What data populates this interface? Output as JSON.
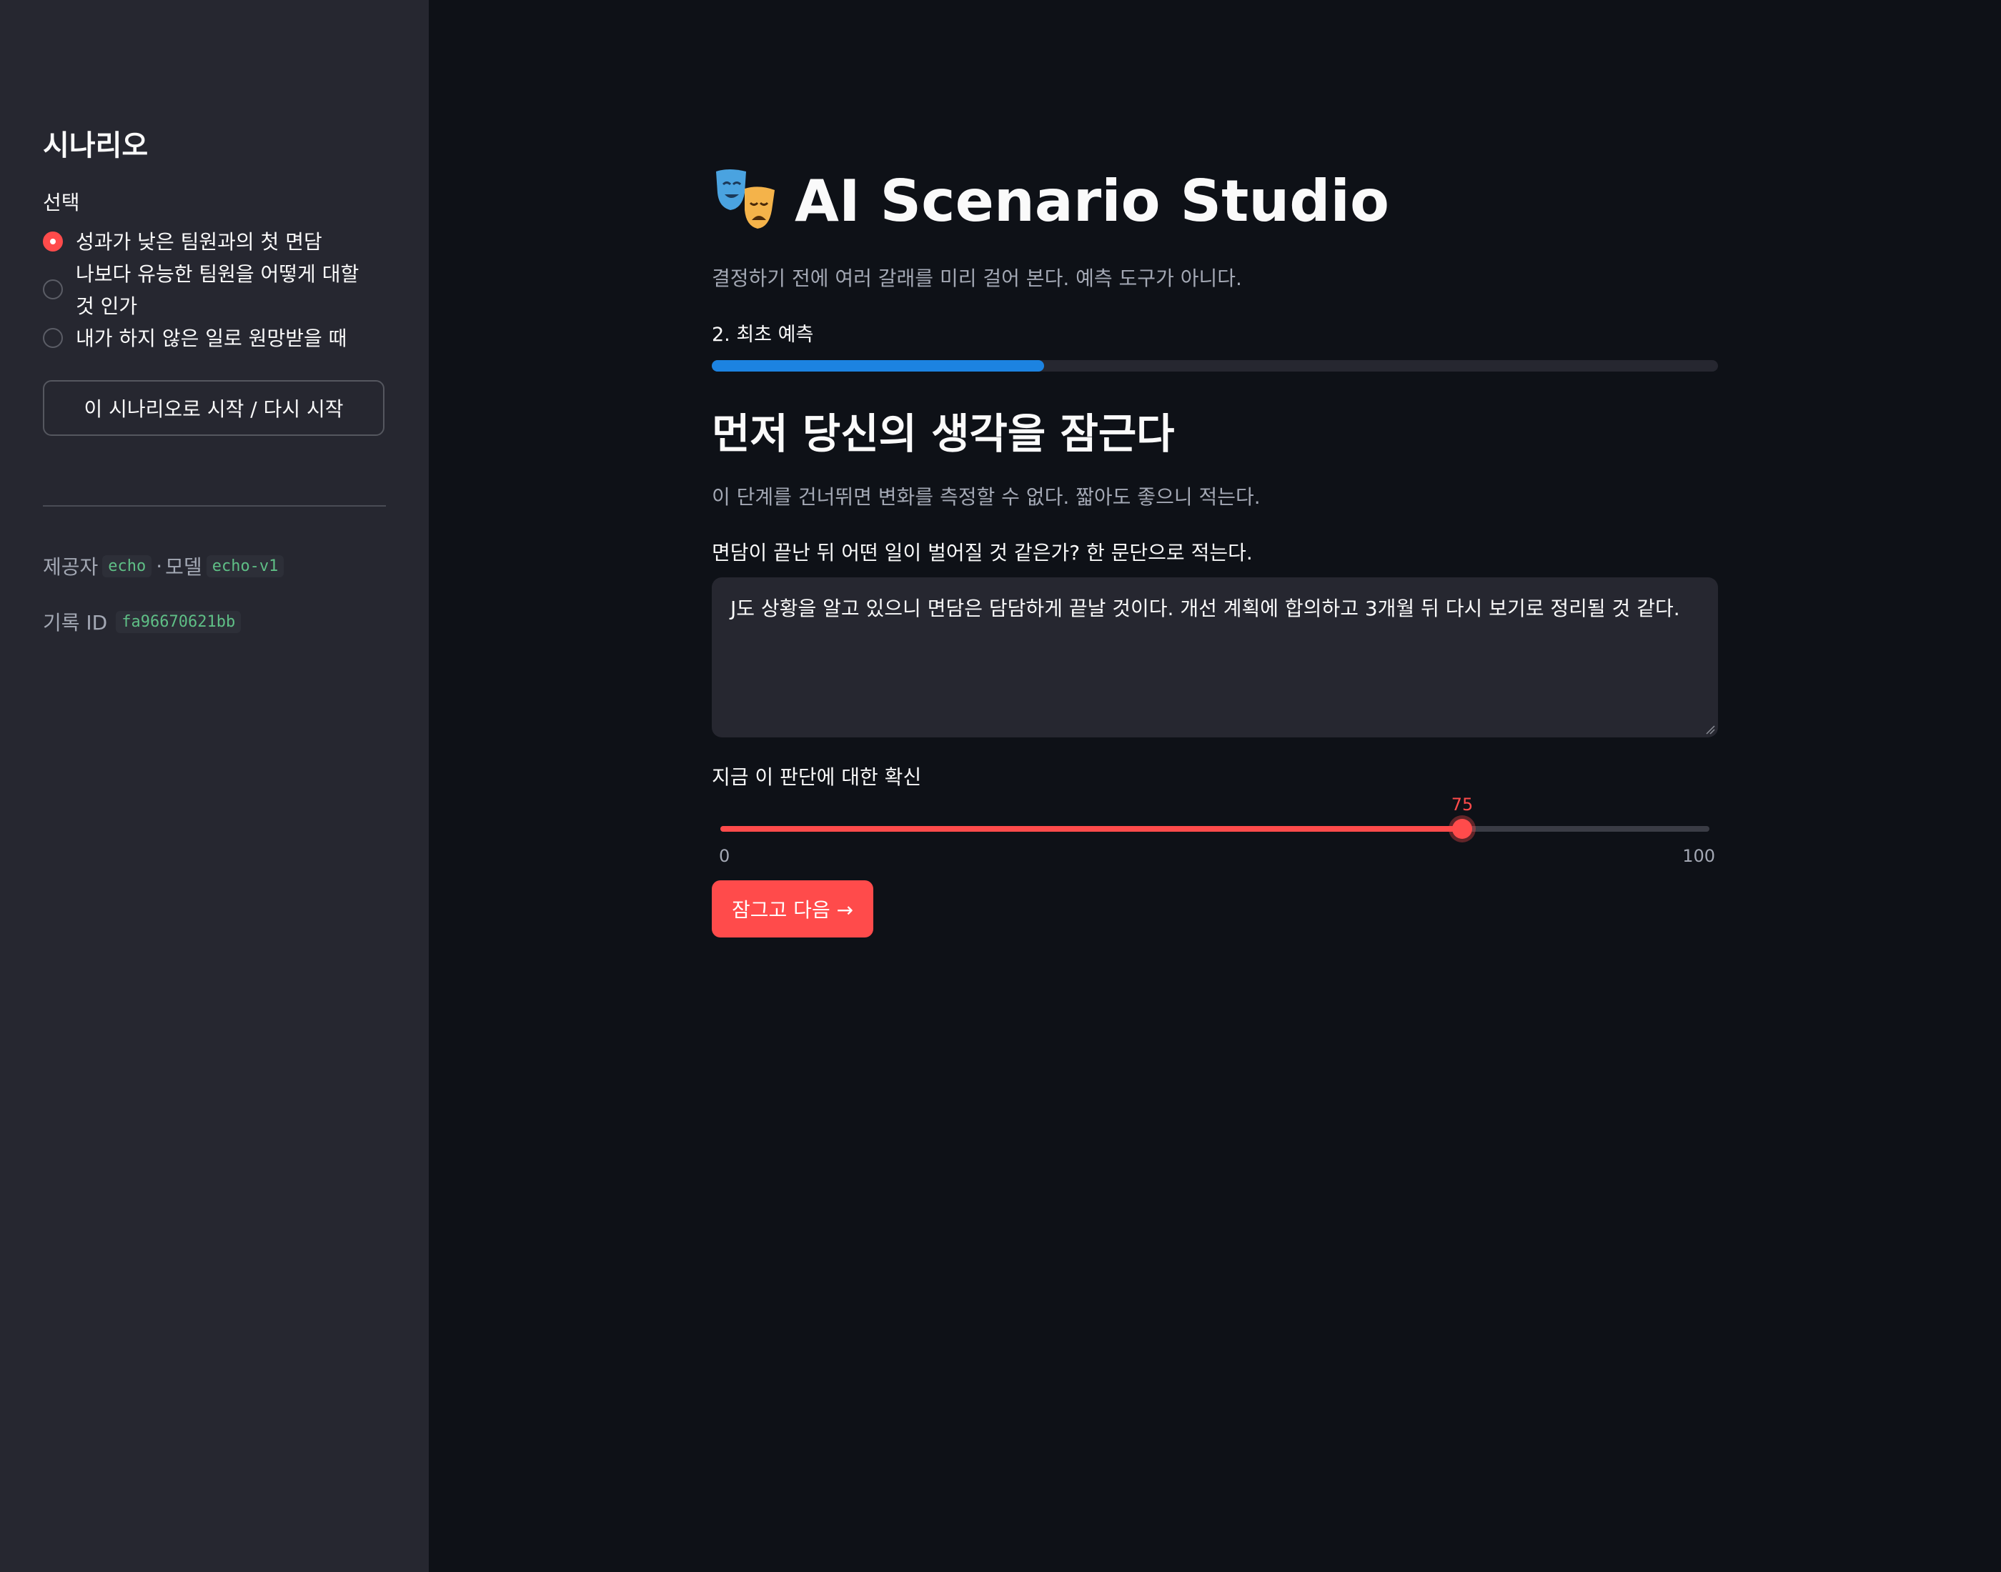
{
  "sidebar": {
    "title": "시나리오",
    "select_label": "선택",
    "options": [
      {
        "label": "성과가 낮은 팀원과의 첫 면담",
        "selected": true
      },
      {
        "label": "나보다 유능한 팀원을 어떻게 대할 것 인가",
        "selected": false
      },
      {
        "label": "내가 하지 않은 일로 원망받을 때",
        "selected": false
      }
    ],
    "start_button": "이 시나리오로 시작 / 다시 시작",
    "provider_label": "제공자",
    "provider_value": "echo",
    "separator": "·",
    "model_label": "모델",
    "model_value": "echo-v1",
    "record_label": "기록 ID",
    "record_value": "fa96670621bb"
  },
  "main": {
    "title": "AI Scenario Studio",
    "title_icon": "theater-masks-icon",
    "subtitle": "결정하기 전에 여러 갈래를 미리 걸어 본다. 예측 도구가 아니다.",
    "step_label": "2. 최초 예측",
    "progress": 0.33,
    "heading": "먼저 당신의 생각을 잠근다",
    "hint": "이 단계를 건너뛰면 변화를 측정할 수 없다. 짧아도 좋으니 적는다.",
    "question_label": "면담이 끝난 뒤 어떤 일이 벌어질 것 같은가? 한 문단으로 적는다.",
    "answer": "J도 상황을 알고 있으니 면담은 담담하게 끝날 것이다. 개선 계획에 합의하고 3개월 뒤 다시 보기로 정리될 것 같다.",
    "confidence_label": "지금 이 판단에 대한 확신",
    "confidence": {
      "min": 0,
      "max": 100,
      "value": 75,
      "min_label": "0",
      "max_label": "100",
      "value_label": "75"
    },
    "next_button": "잠그고 다음 →"
  },
  "colors": {
    "accent": "#ff4b4b",
    "progress": "#1c83e1",
    "background": "#0e1117",
    "sidebar": "#262730"
  }
}
